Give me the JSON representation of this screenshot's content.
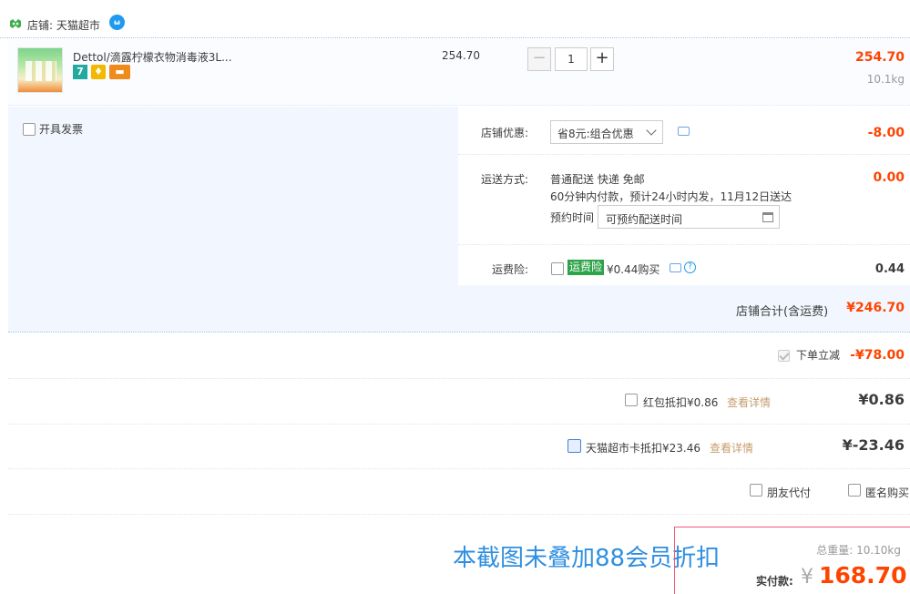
{
  "store": {
    "label": "店铺: 天猫超市"
  },
  "item": {
    "title": "Dettol/滴露柠檬衣物消毒液3L...",
    "unit_price": "254.70",
    "quantity": "1",
    "minus": "−",
    "plus": "+",
    "total": "254.70",
    "weight": "10.1kg",
    "badges": [
      "7"
    ]
  },
  "invoice": {
    "label": "开具发票"
  },
  "discount": {
    "label": "店铺优惠:",
    "selected": "省8元:组合优惠",
    "value": "-8.00"
  },
  "shipping": {
    "label": "运送方式:",
    "method": "普通配送 快递 免邮",
    "detail": "60分钟内付款，预计24小时内发，11月12日送达",
    "schedule_label": "预约时间",
    "schedule_placeholder": "可预约配送时间",
    "value": "0.00"
  },
  "insurance": {
    "label": "运费险:",
    "tag": "运费险",
    "price": "¥0.44购买",
    "help": "?",
    "value": "0.44"
  },
  "store_total": {
    "label": "店铺合计(含运费)",
    "value": "¥246.70"
  },
  "instant_discount": {
    "label": "下单立减",
    "value": "-¥78.00"
  },
  "red_packet": {
    "label": "红包抵扣¥0.86",
    "link": "查看详情",
    "value": "¥0.86"
  },
  "market_card": {
    "label": "天猫超市卡抵扣¥23.46",
    "link": "查看详情",
    "value": "¥-23.46"
  },
  "friend_pay": {
    "label": "朋友代付"
  },
  "anonymous": {
    "label": "匿名购买"
  },
  "overlay": {
    "text": "本截图未叠加88会员折扣"
  },
  "summary": {
    "weight_label": "总重量: 10.10kg",
    "pay_label": "实付款:",
    "currency": "¥",
    "pay_value": "168.70"
  },
  "colors": {
    "price_red": "#ff4400",
    "accent_blue": "#2f8fe0",
    "insurance_green": "#2fa34a"
  }
}
